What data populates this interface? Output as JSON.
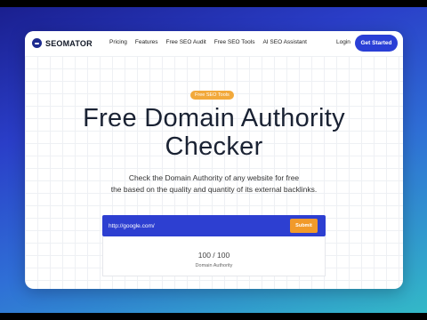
{
  "nav": {
    "logo_text": "SEOMATOR",
    "links": [
      "Pricing",
      "Features",
      "Free SEO Audit",
      "Free SEO Tools",
      "AI SEO Assistant"
    ],
    "login_label": "Login",
    "cta_label": "Get Started"
  },
  "hero": {
    "badge": "Free SEO Tools",
    "title_line1": "Free Domain Authority",
    "title_line2": "Checker",
    "subtitle_line1": "Check the Domain Authority of any website for free",
    "subtitle_line2": "the based on the quality and quantity of its external backlinks."
  },
  "form": {
    "url_value": "http://google.com/",
    "submit_label": "Submit"
  },
  "result": {
    "score": "100 / 100",
    "label": "Domain Authority"
  },
  "colors": {
    "brand": "#2a3fd6",
    "accent": "#f19a2a",
    "backdrop_start": "#1a1f8f",
    "backdrop_end": "#33b9c7"
  },
  "icons": {
    "logo": "seomator-logo-icon"
  }
}
